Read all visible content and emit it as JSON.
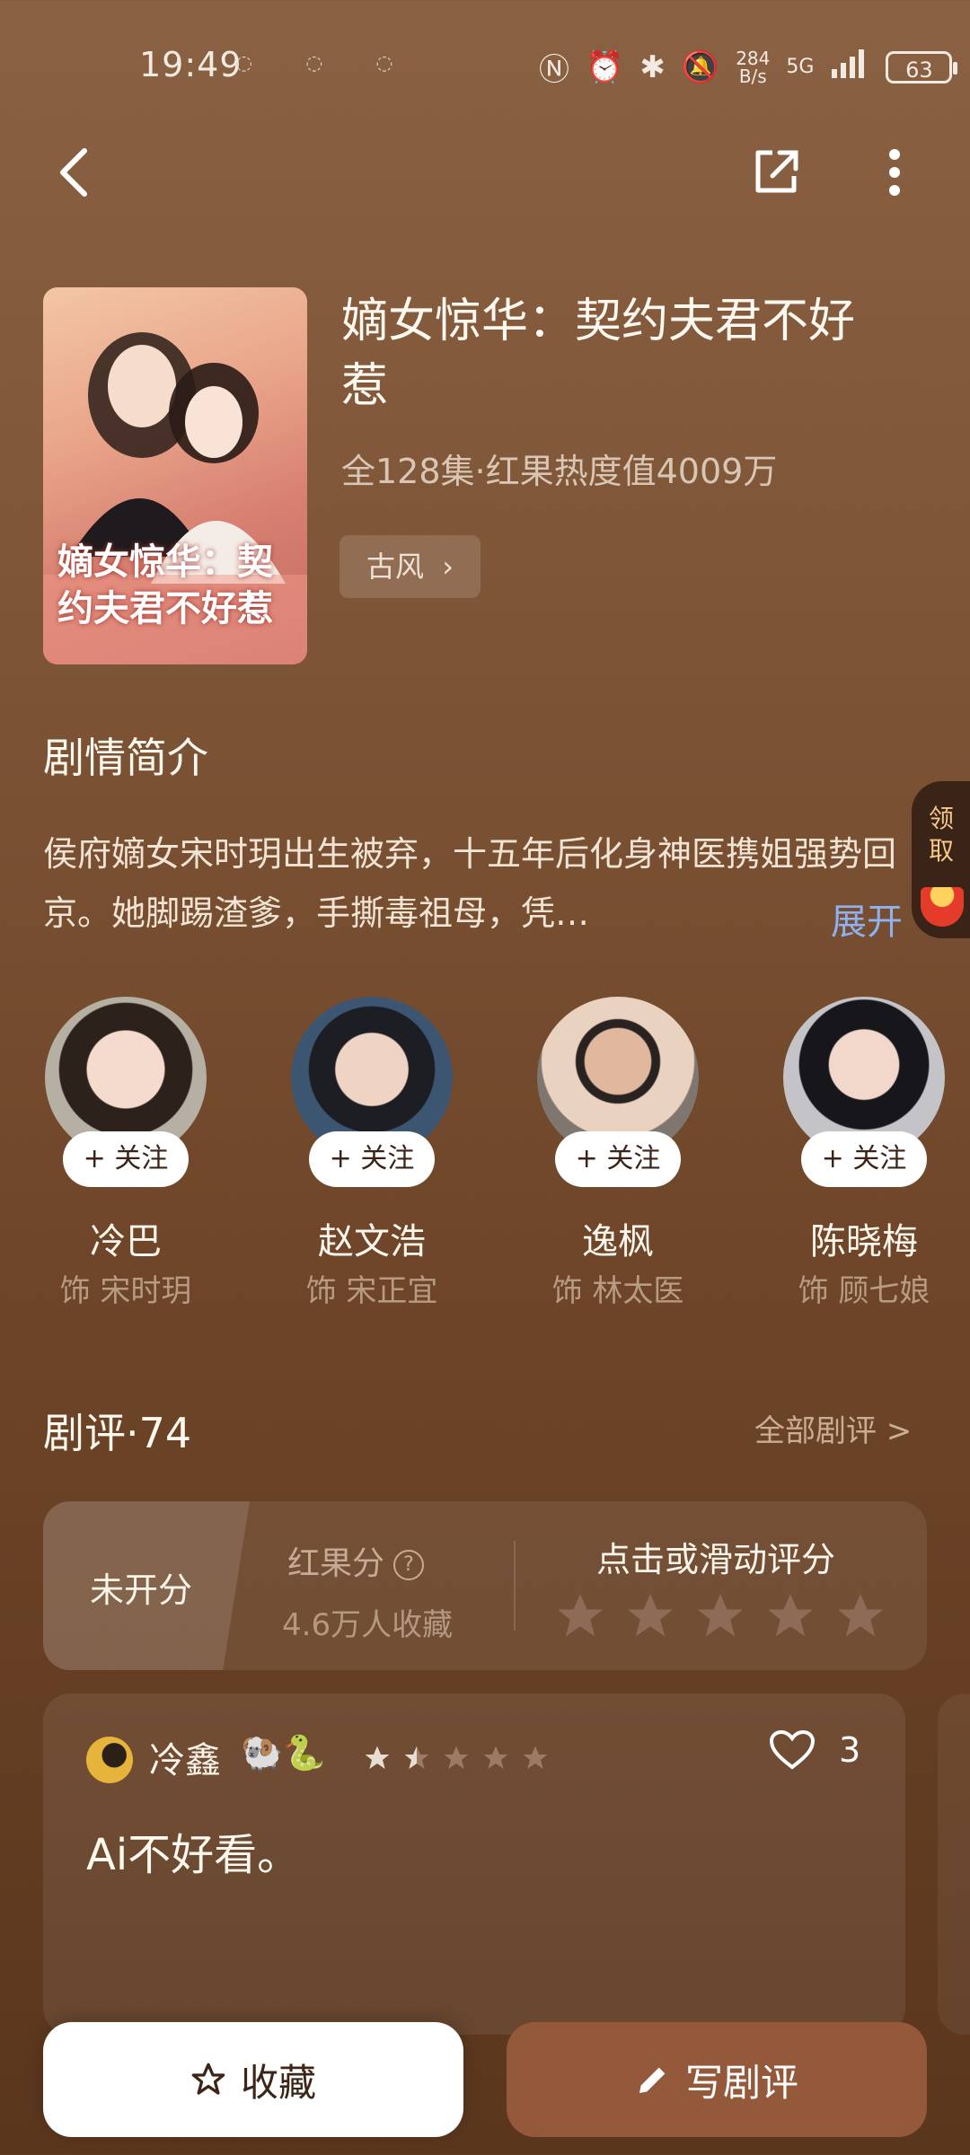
{
  "status_bar": {
    "time": "19:49",
    "notif_dots": "◌ ◌ ◌",
    "net_speed_value": "284",
    "net_speed_unit": "B/s",
    "network": "5G",
    "battery": "63"
  },
  "show": {
    "title": "嫡女惊华：契约夫君不好惹",
    "meta": "全128集·红果热度值4009万",
    "tag": "古风",
    "poster_text": "嫡女惊华：契约夫君不好惹"
  },
  "synopsis": {
    "heading": "剧情简介",
    "text": "侯府嫡女宋时玥出生被弃，十五年后化身神医携姐强势回京。她脚踢渣爹，手撕毒祖母，凭…",
    "expand": "展开"
  },
  "reward": {
    "label": "领取"
  },
  "cast": [
    {
      "name": "冷巴",
      "role": "饰 宋时玥",
      "follow": "+ 关注"
    },
    {
      "name": "赵文浩",
      "role": "饰 宋正宜",
      "follow": "+ 关注"
    },
    {
      "name": "逸枫",
      "role": "饰 林太医",
      "follow": "+ 关注"
    },
    {
      "name": "陈晓梅",
      "role": "饰 顾七娘",
      "follow": "+ 关注"
    }
  ],
  "reviews": {
    "heading": "剧评·74",
    "all_link": "全部剧评 >",
    "unrated": "未开分",
    "score_label": "红果分",
    "fav_count": "4.6万人收藏",
    "tap_to_rate": "点击或滑动评分",
    "rating_stars": 5,
    "items": [
      {
        "user": "冷鑫",
        "user_badges": "🐏🐍",
        "rating": 1.5,
        "likes": "3",
        "text": "Ai不好看。"
      }
    ]
  },
  "actions": {
    "collect": "收藏",
    "write_review": "写剧评"
  },
  "colors": {
    "bg_top": "#8a6143",
    "bg_bottom": "#5a361d",
    "accent_brown": "#93593a",
    "expand_link": "#8fb1f0"
  }
}
